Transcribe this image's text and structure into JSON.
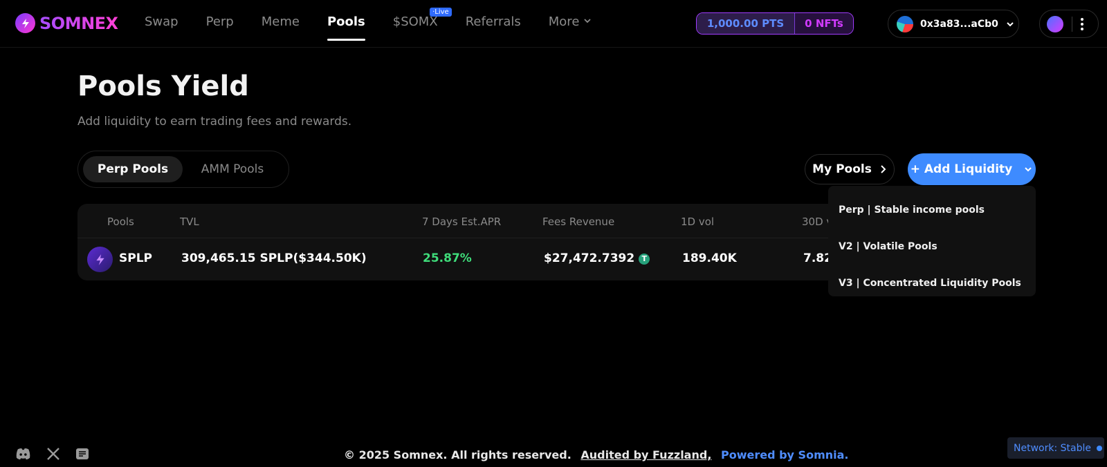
{
  "brand": {
    "name": "SOMNEX"
  },
  "nav": {
    "items": [
      {
        "label": "Swap"
      },
      {
        "label": "Perp"
      },
      {
        "label": "Meme"
      },
      {
        "label": "Pools",
        "active": true
      },
      {
        "label": "$SOMX",
        "badge": "Live"
      },
      {
        "label": "Referrals"
      },
      {
        "label": "More"
      }
    ]
  },
  "header": {
    "points": "1,000.00 PTS",
    "nfts": "0 NFTs",
    "wallet_address": "0x3a83...aCb0"
  },
  "page": {
    "title": "Pools Yield",
    "subtitle": "Add liquidity to earn trading fees and rewards."
  },
  "tabs": [
    {
      "label": "Perp Pools",
      "active": true
    },
    {
      "label": "AMM Pools",
      "active": false
    }
  ],
  "actions": {
    "my_pools": "My Pools",
    "add_liquidity": "+ Add Liquidity"
  },
  "table": {
    "columns": [
      "Pools",
      "TVL",
      "7 Days Est.APR",
      "Fees Revenue",
      "1D vol",
      "30D v"
    ],
    "rows": [
      {
        "pool": "SPLP",
        "tvl": "309,465.15 SPLP($344.50K)",
        "apr": "25.87%",
        "fees": "$27,472.7392",
        "vol_1d": "189.40K",
        "vol_30d": "7.82"
      }
    ]
  },
  "dropdown": {
    "items": [
      "Perp | Stable income pools",
      "V2 | Volatile Pools",
      "V3 | Concentrated Liquidity Pools"
    ]
  },
  "footer": {
    "copyright": "© 2025 Somnex. All rights reserved.",
    "audited": "Audited by Fuzzland,",
    "powered": "Powered by Somnia."
  },
  "network": {
    "label": "Network:",
    "status": "Stable"
  },
  "colors": {
    "accent": "#3e8bff",
    "apr_green": "#3fdc7a",
    "brand_gradient_start": "#a64dff",
    "brand_gradient_end": "#ff3fd6"
  }
}
